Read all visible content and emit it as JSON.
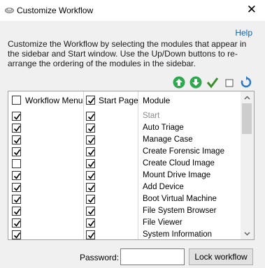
{
  "window": {
    "title": "Customize Workflow",
    "close_glyph": "✕"
  },
  "help_link": "Help",
  "description": "Customize the Workflow by selecting the modules that appear in the sidebar and Start window. Use the Up/Down buttons to re-arrange the ordering of the modules in the sidebar.",
  "toolbar": {
    "buttons": [
      {
        "icon": "move-up-icon",
        "color": "#2fa84f"
      },
      {
        "icon": "move-down-icon",
        "color": "#2fa84f"
      },
      {
        "icon": "check-all-icon",
        "color": "#3a8f2a"
      },
      {
        "icon": "uncheck-all-icon",
        "color": "#555555"
      },
      {
        "icon": "reset-icon",
        "color": "#2a78c8"
      }
    ]
  },
  "table": {
    "headers": {
      "workflow_menu": "Workflow Menu",
      "start_page": "Start Page",
      "module": "Module"
    },
    "header_checks": {
      "workflow_menu": false,
      "start_page": true
    },
    "rows": [
      {
        "module": "Start",
        "workflow_menu": true,
        "start_page": true,
        "disabled": true
      },
      {
        "module": "Auto Triage",
        "workflow_menu": true,
        "start_page": true,
        "disabled": false
      },
      {
        "module": "Manage Case",
        "workflow_menu": true,
        "start_page": true,
        "disabled": false
      },
      {
        "module": "Create Forensic Image",
        "workflow_menu": true,
        "start_page": true,
        "disabled": false
      },
      {
        "module": "Create Cloud Image",
        "workflow_menu": false,
        "start_page": true,
        "disabled": false
      },
      {
        "module": "Mount Drive Image",
        "workflow_menu": true,
        "start_page": true,
        "disabled": false
      },
      {
        "module": "Add Device",
        "workflow_menu": true,
        "start_page": true,
        "disabled": false
      },
      {
        "module": "Boot Virtual Machine",
        "workflow_menu": true,
        "start_page": true,
        "disabled": false
      },
      {
        "module": "File System Browser",
        "workflow_menu": true,
        "start_page": true,
        "disabled": false
      },
      {
        "module": "File Viewer",
        "workflow_menu": true,
        "start_page": true,
        "disabled": false
      },
      {
        "module": "System Information",
        "workflow_menu": true,
        "start_page": true,
        "disabled": false
      }
    ]
  },
  "password": {
    "label": "Password:",
    "value": ""
  },
  "lock_button": "Lock workflow"
}
